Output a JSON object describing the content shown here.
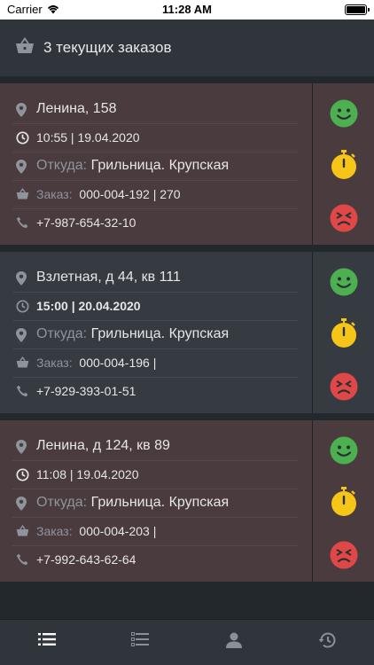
{
  "status_bar": {
    "carrier": "Carrier",
    "time": "11:28 AM"
  },
  "header": {
    "title": "3 текущих заказов",
    "icon": "basket-icon"
  },
  "orders": [
    {
      "address": "Ленина, 158",
      "datetime": "10:55 | 19.04.2020",
      "from_label": "Откуда:",
      "from_value": "Грильница. Крупская",
      "order_label": "Заказ:",
      "order_value": "000-004-192 | 270",
      "phone": "+7-987-654-32-10"
    },
    {
      "address": "Взлетная, д 44, кв 111",
      "datetime": "15:00 | 20.04.2020",
      "from_label": "Откуда:",
      "from_value": "Грильница. Крупская",
      "order_label": "Заказ:",
      "order_value": "000-004-196 |",
      "phone": "+7-929-393-01-51"
    },
    {
      "address": "Ленина, д 124, кв 89",
      "datetime": "11:08 | 19.04.2020",
      "from_label": "Откуда:",
      "from_value": "Грильница. Крупская",
      "order_label": "Заказ:",
      "order_value": "000-004-203 |",
      "phone": "+7-992-643-62-64"
    }
  ],
  "tabs": [
    {
      "name": "orders-list-icon",
      "active": true
    },
    {
      "name": "checklist-icon",
      "active": false
    },
    {
      "name": "profile-icon",
      "active": false
    },
    {
      "name": "history-icon",
      "active": false
    }
  ],
  "colors": {
    "background": "#23282d",
    "header": "#2f353b",
    "card_red": "#4a3b3f",
    "card_dark": "#353b41",
    "happy": "#4caf50",
    "timer": "#f5c518",
    "angry": "#e04848",
    "muted": "#8f949a",
    "tab_active": "#ffffff",
    "tab_inactive": "#8a9096"
  }
}
